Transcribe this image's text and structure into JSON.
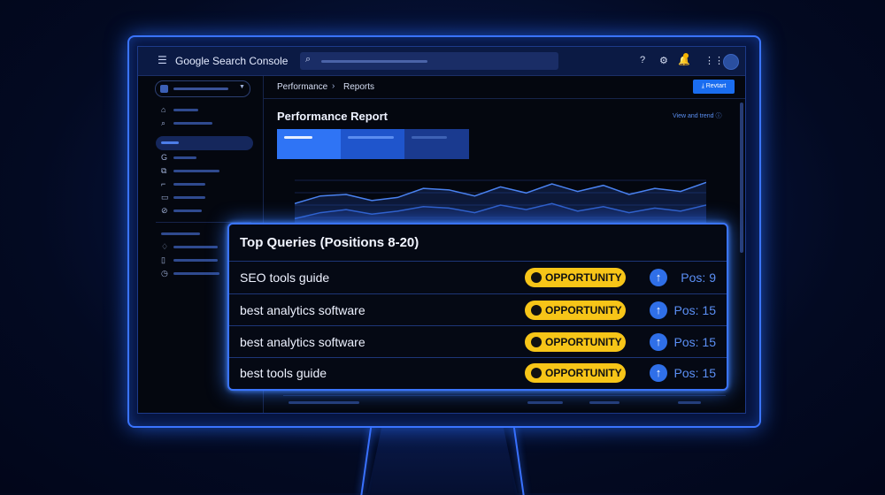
{
  "app": {
    "brand": "Google Search Console",
    "icons": [
      "menu-icon",
      "search-icon",
      "help-icon",
      "settings-icon",
      "bell-icon",
      "apps-icon",
      "avatar"
    ]
  },
  "sidebar": {
    "icons": [
      "home-icon",
      "search-icon",
      "google-icon",
      "pages-icon",
      "sitemap-icon",
      "removals-icon",
      "experience-icon",
      "bell-icon",
      "security-icon",
      "history-icon"
    ]
  },
  "breadcrumb": {
    "item1": "Performance",
    "separator": "›",
    "item2": "Reports"
  },
  "toolbar": {
    "export_label": "Revtart"
  },
  "report": {
    "title": "Performance Report",
    "view_trend": "View and trend"
  },
  "chart_data": {
    "type": "line",
    "series": [
      {
        "values": [
          30,
          40,
          42,
          34,
          38,
          50,
          48,
          40,
          52,
          44,
          56,
          46,
          54,
          42,
          50,
          46,
          58
        ]
      },
      {
        "values": [
          10,
          18,
          22,
          16,
          20,
          26,
          24,
          18,
          28,
          22,
          30,
          20,
          26,
          18,
          24,
          20,
          28
        ]
      }
    ],
    "grid": true
  },
  "top_queries": {
    "title": "Top Queries (Positions 8-20)",
    "rows": [
      {
        "query": "SEO tools guide",
        "badge": "OPPORTUNITY",
        "position": "Pos: 9"
      },
      {
        "query": "best analytics software",
        "badge": "OPPORTUNITY",
        "position": "Pos: 15"
      },
      {
        "query": "best analytics software",
        "badge": "OPPORTUNITY",
        "position": "Pos: 15"
      },
      {
        "query": "best tools guide",
        "badge": "OPPORTUNITY",
        "position": "Pos: 15"
      }
    ]
  },
  "colors": {
    "accent": "#3a74ff",
    "badge": "#f7c518",
    "position_text": "#5b8ff5",
    "button": "#1a6df0"
  }
}
